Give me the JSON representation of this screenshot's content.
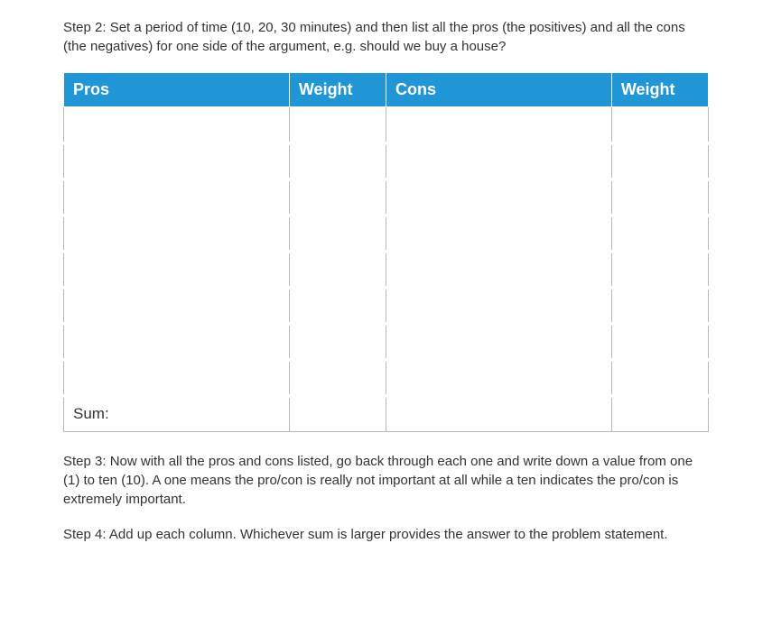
{
  "step2": "Step 2: Set a period of time (10, 20, 30 minutes) and then list all the pros (the positives) and all the cons (the negatives) for one side of the argument, e.g. should we buy a house?",
  "step3": "Step 3: Now with all the pros and cons listed, go back through each one and write down a value from one (1) to ten (10). A one means the pro/con is really not important at all while a ten indicates the pro/con is extremely important.",
  "step4": "Step 4: Add up each column. Whichever sum is larger provides the answer to the problem statement.",
  "table": {
    "headers": {
      "pros": "Pros",
      "pros_weight": "Weight",
      "cons": "Cons",
      "cons_weight": "Weight"
    },
    "rows": [
      {
        "pro": "",
        "pro_weight": "",
        "con": "",
        "con_weight": ""
      },
      {
        "pro": "",
        "pro_weight": "",
        "con": "",
        "con_weight": ""
      },
      {
        "pro": "",
        "pro_weight": "",
        "con": "",
        "con_weight": ""
      },
      {
        "pro": "",
        "pro_weight": "",
        "con": "",
        "con_weight": ""
      },
      {
        "pro": "",
        "pro_weight": "",
        "con": "",
        "con_weight": ""
      },
      {
        "pro": "",
        "pro_weight": "",
        "con": "",
        "con_weight": ""
      },
      {
        "pro": "",
        "pro_weight": "",
        "con": "",
        "con_weight": ""
      },
      {
        "pro": "",
        "pro_weight": "",
        "con": "",
        "con_weight": ""
      }
    ],
    "sum_label": "Sum:",
    "sum": {
      "pro_weight": "",
      "con": "",
      "con_weight": ""
    }
  }
}
